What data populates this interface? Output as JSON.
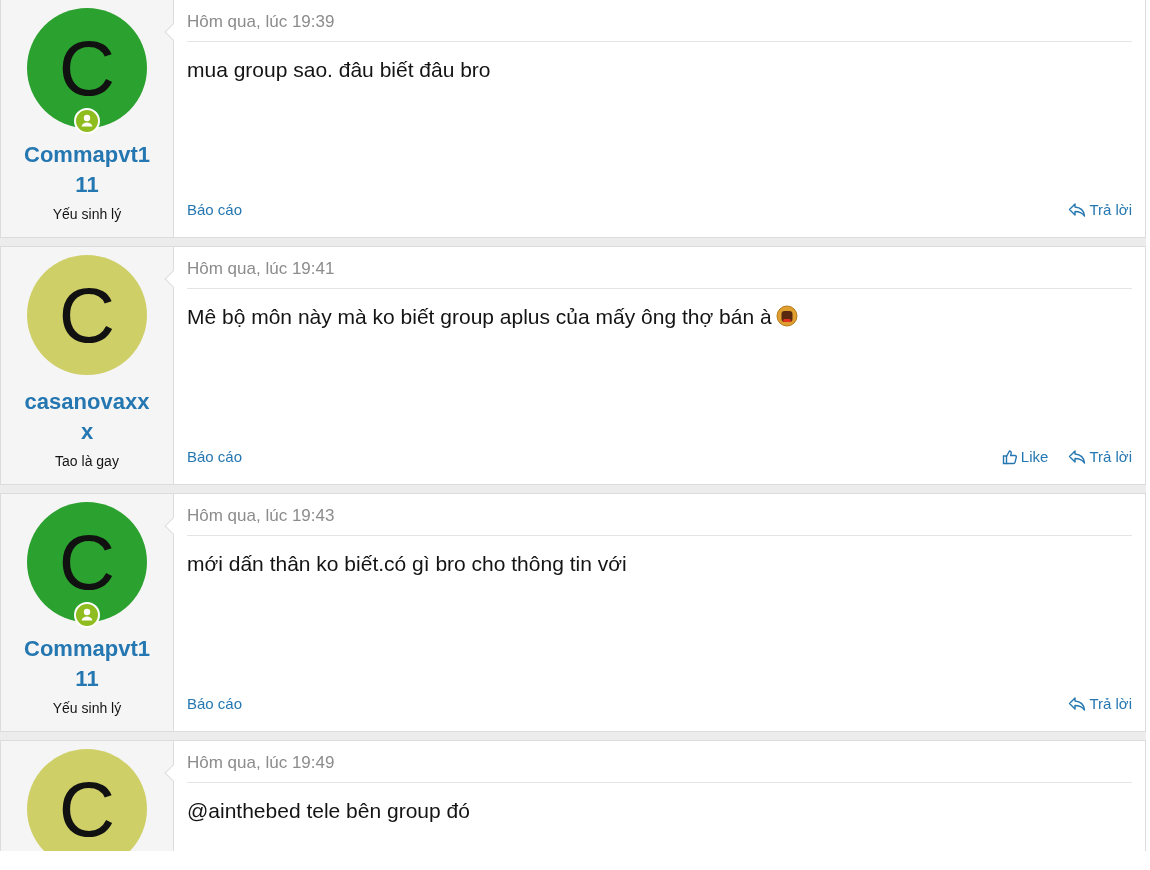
{
  "posts": [
    {
      "avatar_letter": "C",
      "color": "#2ba12f",
      "online": true,
      "username": "Commapvt111",
      "user_title": "Yếu sinh lý",
      "time": "Hôm qua, lúc 19:39",
      "message": "mua group sao. đâu biết đâu bro",
      "trailing_emoji": false,
      "report": "Báo cáo",
      "actions": [
        {
          "kind": "reply",
          "label": "Trả lời"
        }
      ]
    },
    {
      "avatar_letter": "C",
      "color": "#cfcf68",
      "online": false,
      "username": "casanovaxxx",
      "user_title": "Tao là gay",
      "time": "Hôm qua, lúc 19:41",
      "message": "Mê bộ môn này mà ko biết group aplus của mấy ông thợ bán à",
      "trailing_emoji": true,
      "report": "Báo cáo",
      "actions": [
        {
          "kind": "like",
          "label": "Like"
        },
        {
          "kind": "reply",
          "label": "Trả lời"
        }
      ]
    },
    {
      "avatar_letter": "C",
      "color": "#2ba12f",
      "online": true,
      "username": "Commapvt111",
      "user_title": "Yếu sinh lý",
      "time": "Hôm qua, lúc 19:43",
      "message": "mới dấn thân ko biết.có gì bro cho thông tin với",
      "trailing_emoji": false,
      "report": "Báo cáo",
      "actions": [
        {
          "kind": "reply",
          "label": "Trả lời"
        }
      ]
    },
    {
      "avatar_letter": "C",
      "color": "#cfcf68",
      "online": false,
      "time": "Hôm qua, lúc 19:49",
      "message": "@ainthebed tele bên group đó",
      "trailing_emoji": false
    }
  ]
}
